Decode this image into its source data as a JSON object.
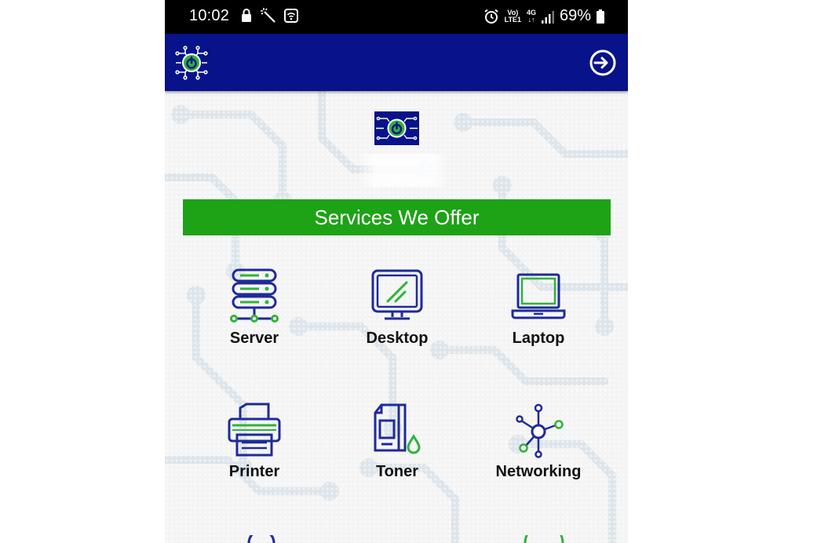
{
  "status_bar": {
    "time": "10:02",
    "net_top": "Vo)",
    "net_bottom": "LTE1",
    "signal_top": "4G",
    "signal_bottom": "↓↑",
    "battery": "69%"
  },
  "app_bar": {
    "logo_icon": "power-circuit-logo",
    "action_icon": "login-arrow-icon"
  },
  "banner": {
    "title": "Services We Offer"
  },
  "services": [
    {
      "label": "Server",
      "icon": "server-icon"
    },
    {
      "label": "Desktop",
      "icon": "desktop-icon"
    },
    {
      "label": "Laptop",
      "icon": "laptop-icon"
    },
    {
      "label": "Printer",
      "icon": "printer-icon"
    },
    {
      "label": "Toner",
      "icon": "toner-icon"
    },
    {
      "label": "Networking",
      "icon": "networking-icon"
    }
  ],
  "colors": {
    "app_bar": "#08128a",
    "banner": "#1ea216",
    "icon_blue": "#1f2a9a",
    "icon_green": "#2fb33a"
  }
}
